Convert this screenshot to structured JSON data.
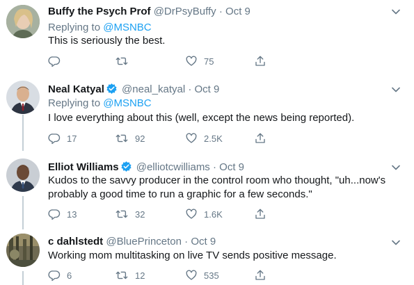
{
  "replying_to_prefix": "Replying to ",
  "separator": "·",
  "tweets": [
    {
      "name": "Buffy the Psych Prof",
      "handle": "@DrPsyBuffy",
      "date": "Oct 9",
      "verified": false,
      "replying_to": "@MSNBC",
      "text": "This is seriously the best.",
      "replies": "",
      "retweets": "",
      "likes": "75"
    },
    {
      "name": "Neal Katyal",
      "handle": "@neal_katyal",
      "date": "Oct 9",
      "verified": true,
      "replying_to": "@MSNBC",
      "text": "I love everything about this (well, except the news being reported).",
      "replies": "17",
      "retweets": "92",
      "likes": "2.5K"
    },
    {
      "name": "Elliot Williams",
      "handle": "@elliotcwilliams",
      "date": "Oct 9",
      "verified": true,
      "text": "Kudos to the savvy producer in the control room who thought, \"uh...now's probably a good time to run a graphic for a few seconds.\"",
      "replies": "13",
      "retweets": "32",
      "likes": "1.6K"
    },
    {
      "name": "c dahlstedt",
      "handle": "@BluePrinceton",
      "date": "Oct 9",
      "verified": false,
      "text": "Working mom multitasking on live TV sends positive message.",
      "replies": "6",
      "retweets": "12",
      "likes": "535"
    }
  ],
  "colors": {
    "accent": "#1da1f2",
    "muted": "#657786",
    "text": "#14171a",
    "thread": "#c4cfd6"
  }
}
